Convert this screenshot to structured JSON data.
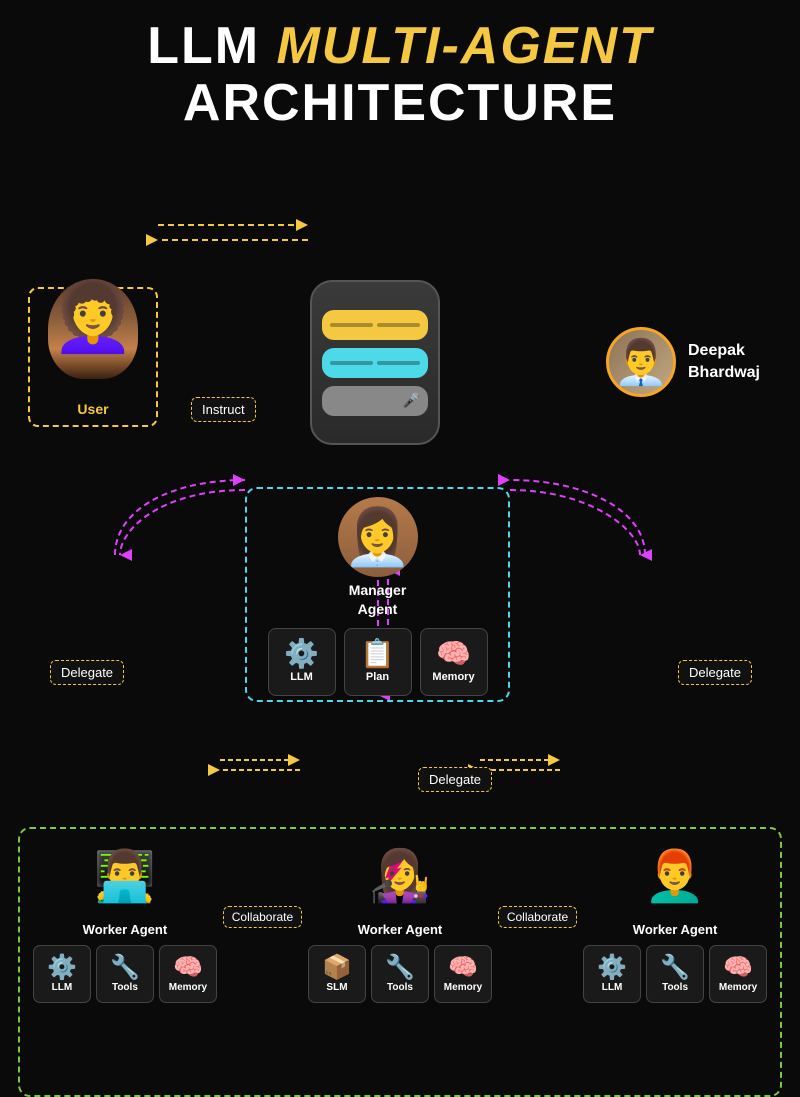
{
  "title": {
    "line1_white": "LLM",
    "line1_yellow": "MULTI-AGENT",
    "line2": "ARCHITECTURE"
  },
  "author": {
    "name_line1": "Deepak",
    "name_line2": "Bhardwaj"
  },
  "user": {
    "label": "User"
  },
  "manager": {
    "label_line1": "Manager",
    "label_line2": "Agent",
    "tools": [
      {
        "icon": "⚙",
        "label": "LLM"
      },
      {
        "icon": "≡",
        "label": "Plan"
      },
      {
        "icon": "🧠",
        "label": "Memory"
      }
    ]
  },
  "labels": {
    "instruct": "Instruct",
    "delegate_left": "Delegate",
    "delegate_center": "Delegate",
    "delegate_right": "Delegate",
    "collaborate1": "Collaborate",
    "collaborate2": "Collaborate"
  },
  "workers": [
    {
      "label": "Worker Agent",
      "tools": [
        {
          "icon": "⚙",
          "label": "LLM"
        },
        {
          "icon": "🔧",
          "label": "Tools"
        },
        {
          "icon": "🧠",
          "label": "Memory"
        }
      ]
    },
    {
      "label": "Worker Agent",
      "tools": [
        {
          "icon": "📦",
          "label": "SLM"
        },
        {
          "icon": "🔧",
          "label": "Tools"
        },
        {
          "icon": "🧠",
          "label": "Memory"
        }
      ]
    },
    {
      "label": "Worker Agent",
      "tools": [
        {
          "icon": "⚙",
          "label": "LLM"
        },
        {
          "icon": "🔧",
          "label": "Tools"
        },
        {
          "icon": "🧠",
          "label": "Memory"
        }
      ]
    }
  ]
}
